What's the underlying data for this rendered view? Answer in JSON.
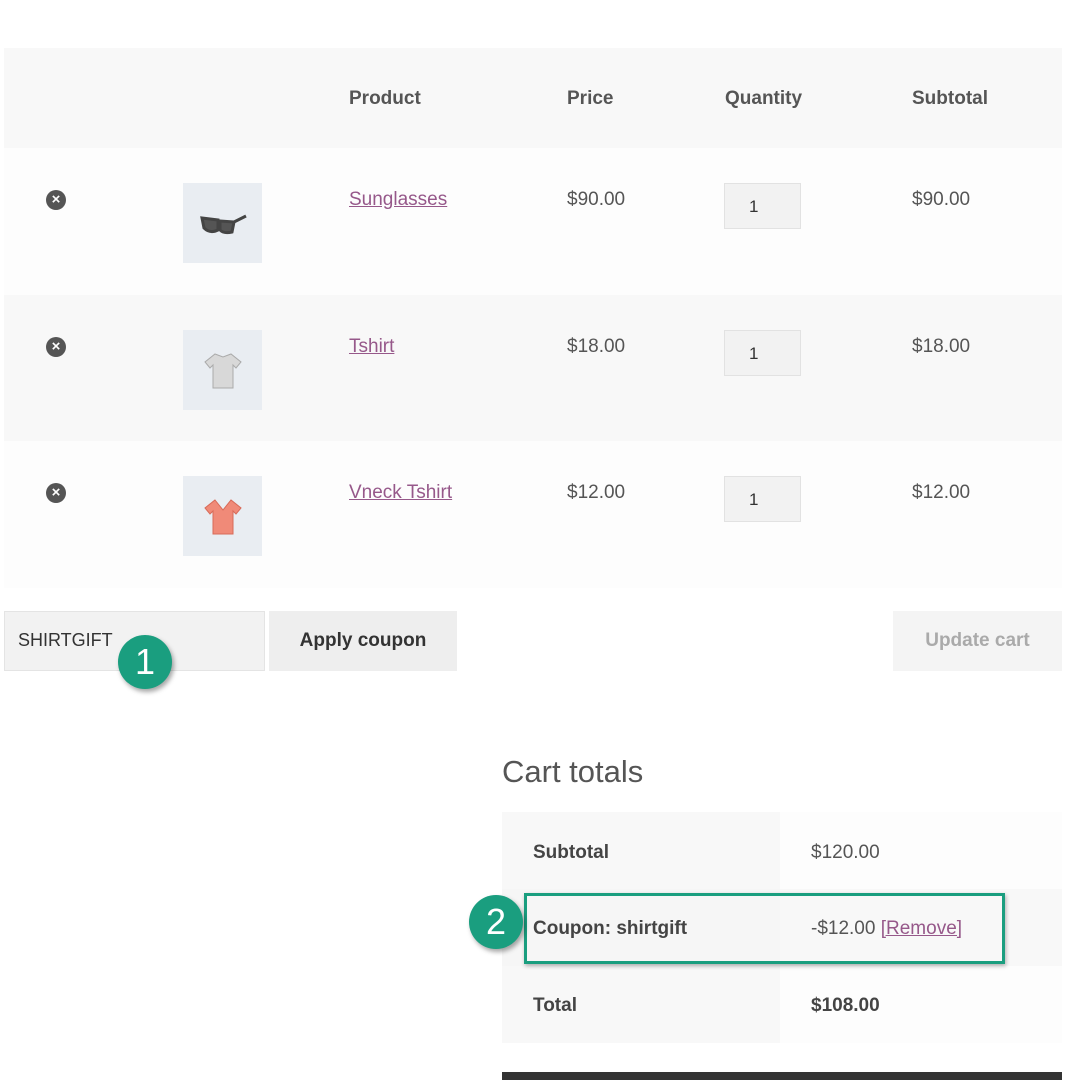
{
  "columns": {
    "product": "Product",
    "price": "Price",
    "quantity": "Quantity",
    "subtotal": "Subtotal"
  },
  "items": [
    {
      "name": "Sunglasses",
      "price": "$90.00",
      "qty": "1",
      "subtotal": "$90.00",
      "icon": "sunglasses-icon"
    },
    {
      "name": "Tshirt",
      "price": "$18.00",
      "qty": "1",
      "subtotal": "$18.00",
      "icon": "tshirt-icon"
    },
    {
      "name": "Vneck Tshirt",
      "price": "$12.00",
      "qty": "1",
      "subtotal": "$12.00",
      "icon": "vneck-tshirt-icon"
    }
  ],
  "coupon": {
    "value": "SHIRTGIFT",
    "apply_label": "Apply coupon",
    "update_label": "Update cart"
  },
  "callouts": {
    "one": "1",
    "two": "2"
  },
  "totals": {
    "title": "Cart totals",
    "subtotal_label": "Subtotal",
    "subtotal": "$120.00",
    "coupon_label": "Coupon: shirtgift",
    "coupon_value": "-$12.00",
    "remove_label": "[Remove]",
    "total_label": "Total",
    "total": "$108.00"
  },
  "colors": {
    "accent": "#1a9e7f",
    "link": "#96588a"
  }
}
